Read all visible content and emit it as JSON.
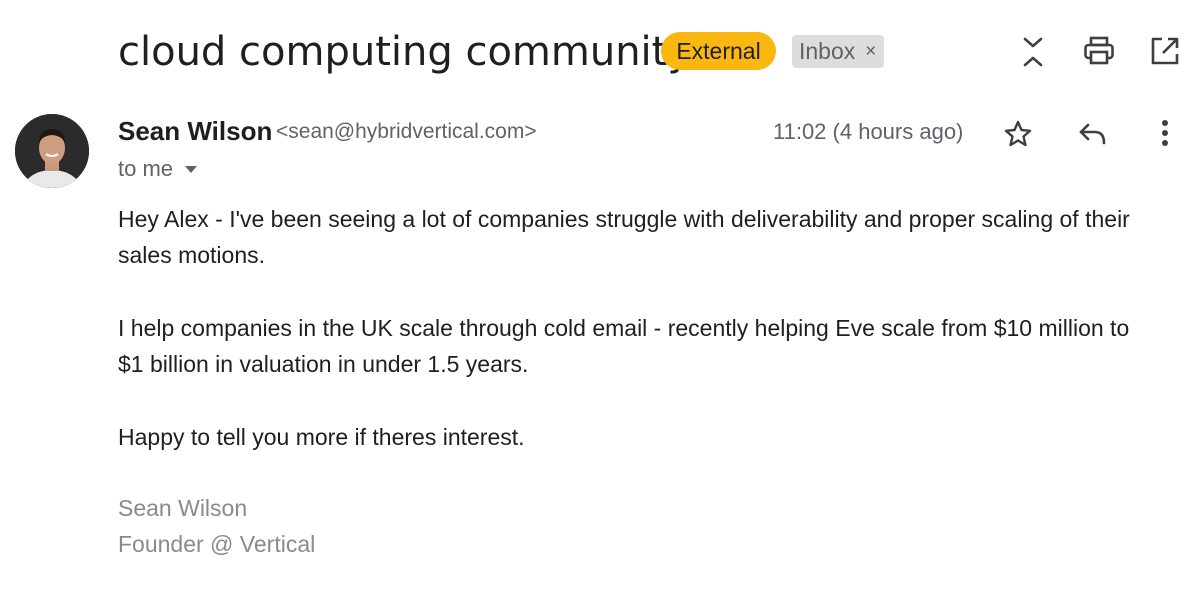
{
  "email": {
    "subject": "cloud computing community",
    "labels": {
      "external": "External",
      "inbox": "Inbox",
      "inbox_remove": "×"
    },
    "sender": {
      "name": "Sean Wilson",
      "email": "<sean@hybridvertical.com>"
    },
    "time": "11:02 (4 hours ago)",
    "recipient": "to me",
    "body": {
      "paragraph_1_line_1": "Hey Alex - I've been seeing a lot of companies struggle with deliverability and proper scaling of their",
      "paragraph_1_line_2": "sales motions.",
      "paragraph_2_line_1": "I help companies in the UK scale through cold email - recently helping Eve scale from $10 million to",
      "paragraph_2_line_2": "$1 billion in valuation in under 1.5 years.",
      "paragraph_3": "Happy to tell you more if theres interest."
    },
    "signature": {
      "name": "Sean Wilson",
      "title": "Founder @ Vertical"
    }
  },
  "toolbar": {
    "icons": [
      "expand-collapse-icon",
      "print-icon",
      "open-in-new-window-icon"
    ]
  },
  "message_actions": {
    "icons": [
      "star-icon",
      "reply-icon",
      "more-vert-icon"
    ]
  },
  "colors": {
    "external_badge": "#f9b70f",
    "inbox_badge": "#dddddd",
    "text_primary": "#1f1f1f",
    "text_secondary": "#5f6368",
    "signature": "#8a8a8a"
  }
}
